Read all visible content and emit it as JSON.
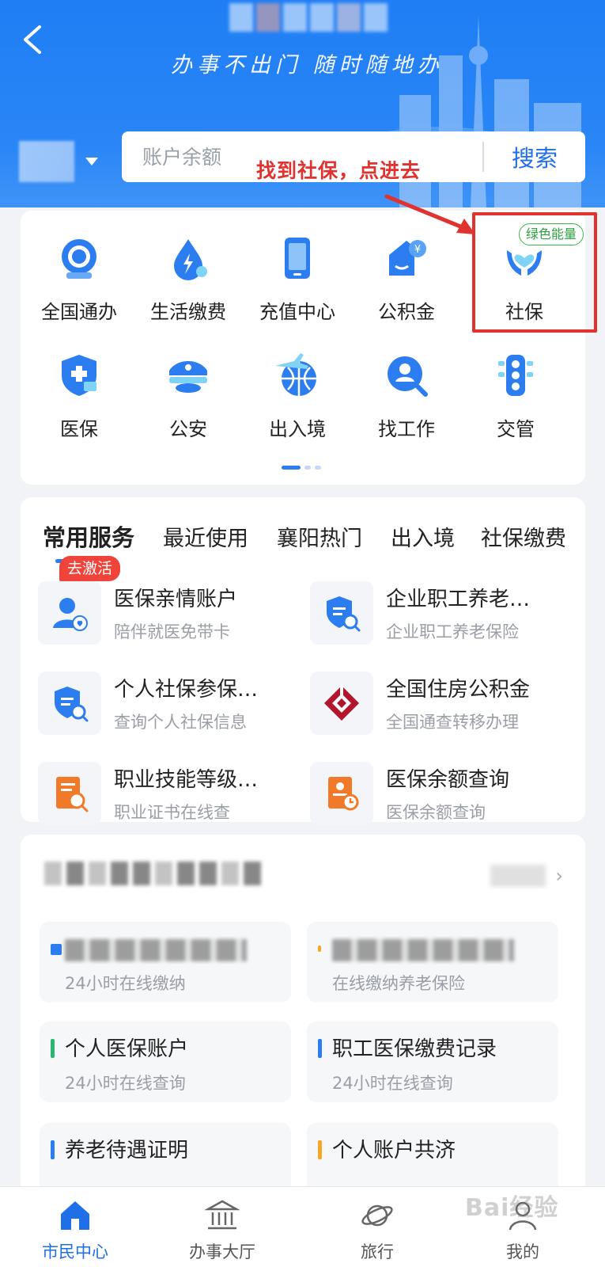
{
  "header": {
    "slogan": "办事不出门 随时随地办",
    "search_placeholder": "账户余额",
    "search_button": "搜索"
  },
  "annotation": {
    "text": "找到社保，点进去"
  },
  "grid": {
    "row1": [
      {
        "label": "全国通办",
        "icon": "globe-service-icon"
      },
      {
        "label": "生活缴费",
        "icon": "utility-drop-icon"
      },
      {
        "label": "充值中心",
        "icon": "phone-topup-icon"
      },
      {
        "label": "公积金",
        "icon": "housing-fund-icon"
      },
      {
        "label": "社保",
        "icon": "social-security-hands-icon",
        "badge": "绿色能量"
      }
    ],
    "row2": [
      {
        "label": "医保",
        "icon": "medical-shield-icon"
      },
      {
        "label": "公安",
        "icon": "police-cap-icon"
      },
      {
        "label": "出入境",
        "icon": "plane-globe-icon"
      },
      {
        "label": "找工作",
        "icon": "job-search-icon"
      },
      {
        "label": "交管",
        "icon": "traffic-light-icon"
      }
    ]
  },
  "services": {
    "tabs": [
      "常用服务",
      "最近使用",
      "襄阳热门",
      "出入境",
      "社保缴费"
    ],
    "active_tab": "常用服务",
    "activate_badge": "去激活",
    "items": [
      {
        "title": "医保亲情账户",
        "sub": "陪伴就医免带卡",
        "icon": "family-account-icon"
      },
      {
        "title": "企业职工养老…",
        "sub": "企业职工养老保险",
        "icon": "pension-shield-search-icon"
      },
      {
        "title": "个人社保参保…",
        "sub": "查询个人社保信息",
        "icon": "social-security-search-icon"
      },
      {
        "title": "全国住房公积金",
        "sub": "全国通查转移办理",
        "icon": "housing-fund-logo-icon"
      },
      {
        "title": "职业技能等级…",
        "sub": "职业证书在线查",
        "icon": "certificate-search-icon"
      },
      {
        "title": "医保余额查询",
        "sub": "医保余额查询",
        "icon": "balance-query-icon"
      }
    ]
  },
  "quick": {
    "items": [
      {
        "title": "",
        "sub": "24小时在线缴纳",
        "bar": "#2b7df0",
        "blurred": true
      },
      {
        "title": "",
        "sub": "在线缴纳养老保险",
        "bar": "#f5a623",
        "blurred": true
      },
      {
        "title": "个人医保账户",
        "sub": "24小时在线查询",
        "bar": "#2bb673"
      },
      {
        "title": "职工医保缴费记录",
        "sub": "24小时在线查询",
        "bar": "#2b7df0"
      },
      {
        "title": "养老待遇证明",
        "sub": "",
        "bar": "#2b7df0"
      },
      {
        "title": "个人账户共济",
        "sub": "",
        "bar": "#f5a623"
      }
    ]
  },
  "nav": [
    {
      "label": "市民中心",
      "icon": "home-icon",
      "active": true
    },
    {
      "label": "办事大厅",
      "icon": "bank-hall-icon"
    },
    {
      "label": "旅行",
      "icon": "planet-icon"
    },
    {
      "label": "我的",
      "icon": "user-icon"
    }
  ],
  "watermark": "Bai经验",
  "colors": {
    "primary": "#1f7ef5",
    "annotation": "#e0322f",
    "energy": "#39b54a"
  }
}
